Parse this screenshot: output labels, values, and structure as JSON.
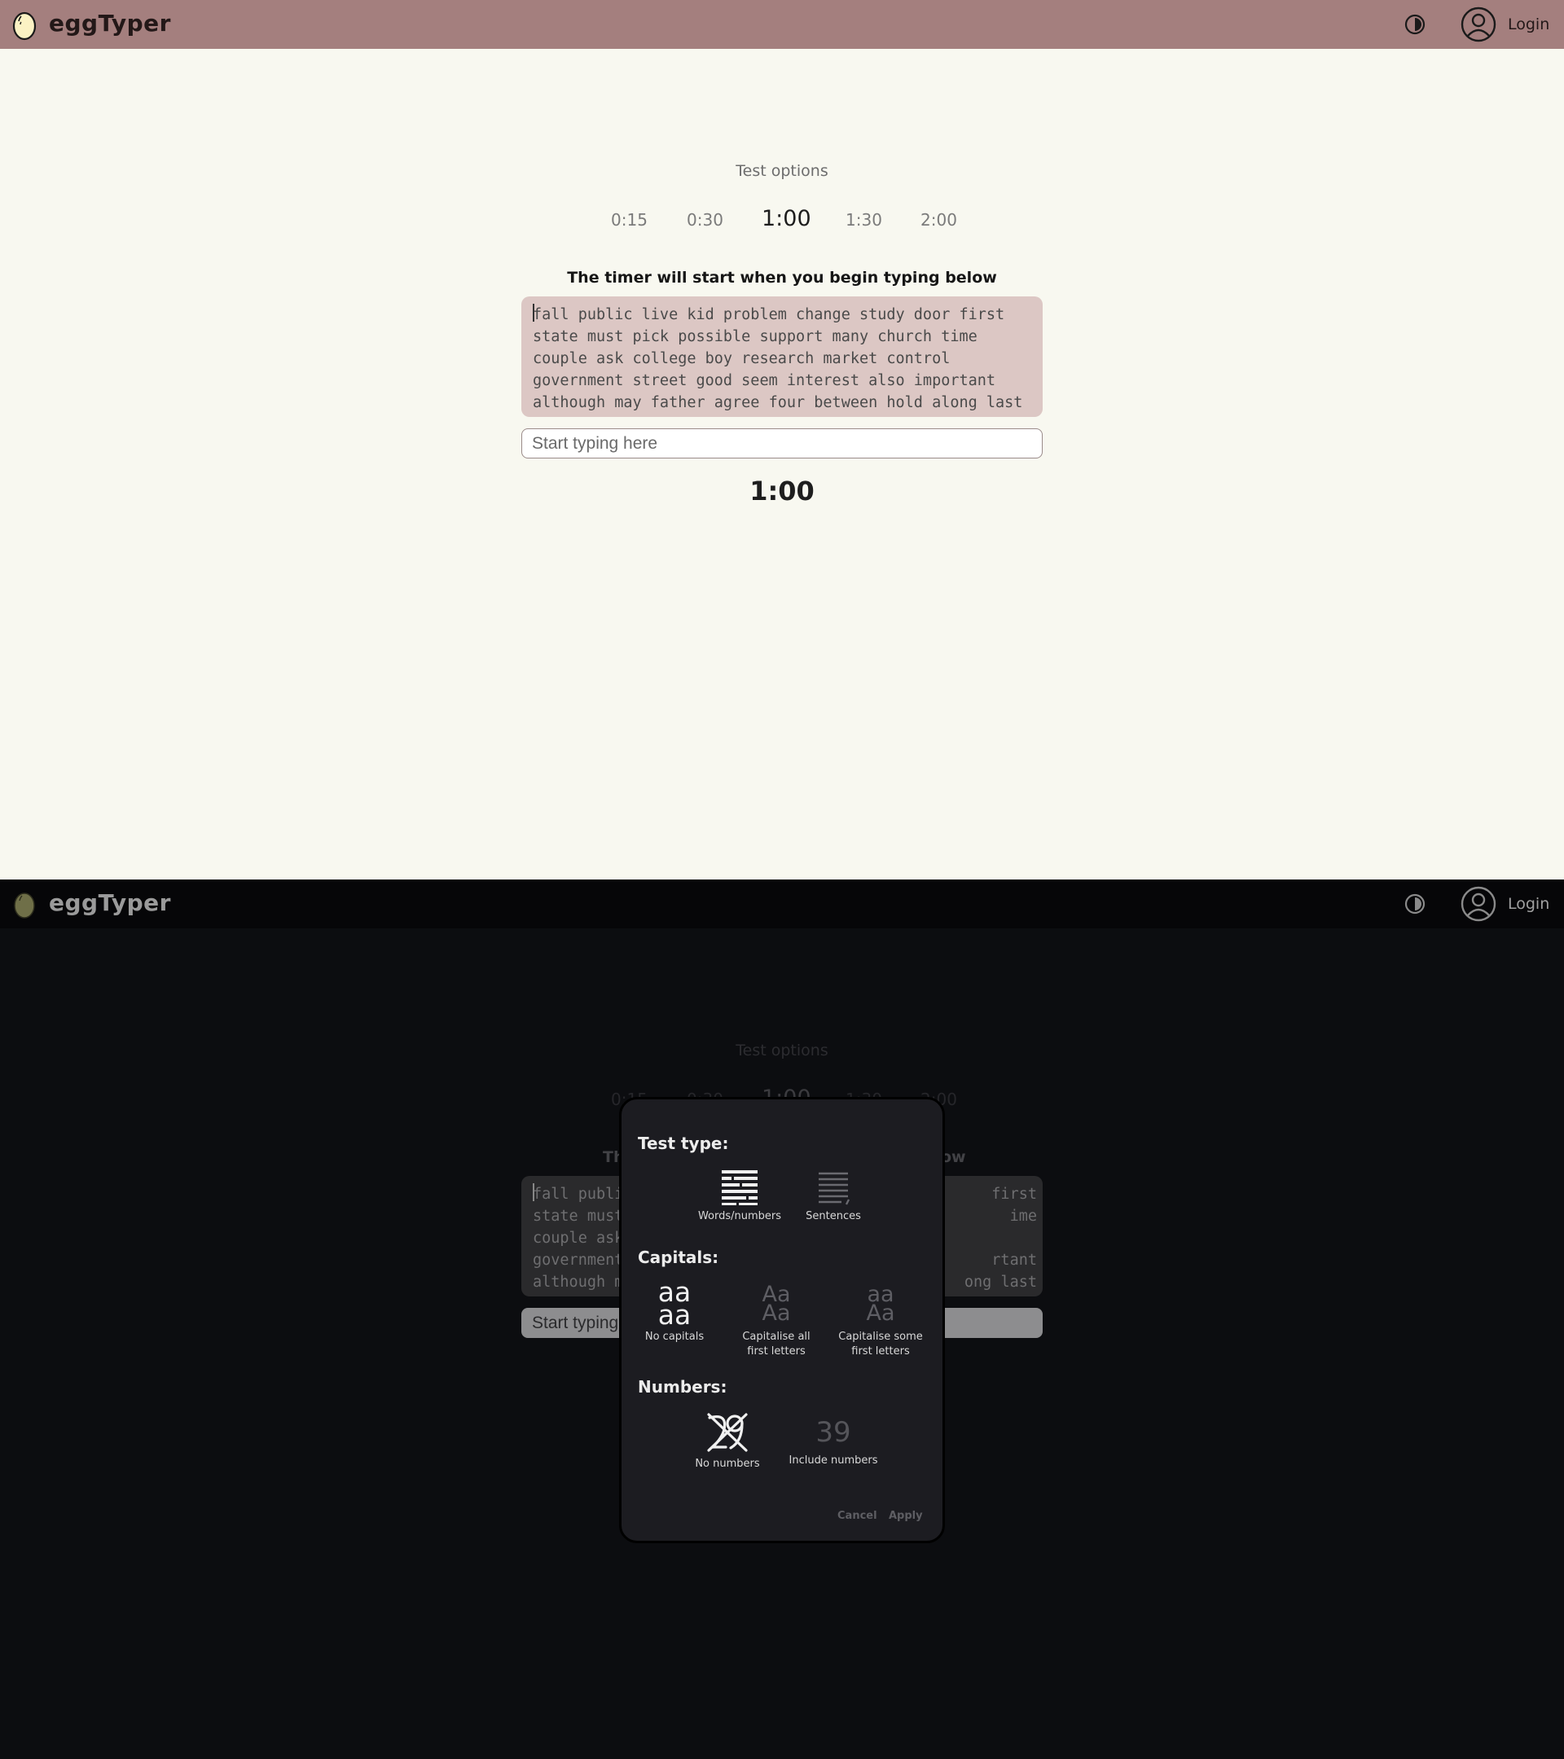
{
  "app": {
    "brand": "eggTyper"
  },
  "header": {
    "login_label": "Login"
  },
  "test_options": {
    "title": "Test options",
    "durations": [
      "0:15",
      "0:30",
      "1:00",
      "1:30",
      "2:00"
    ],
    "selected_duration": "1:00"
  },
  "typing": {
    "timer_note": "The timer will start when you begin typing below",
    "word_lines": [
      "fall public live kid problem change study door first",
      "state must pick possible support many church time",
      "couple ask college boy research market control",
      "government street good seem interest also important",
      "although may father agree four between hold along last"
    ],
    "input_placeholder": "Start typing here",
    "countdown": "1:00"
  },
  "dark_view": {
    "word_lines_left": [
      "fall publi",
      "state must",
      "couple ask",
      "government",
      "although m"
    ],
    "word_lines_right": [
      "first",
      "ime",
      "",
      "rtant",
      "ong last"
    ],
    "timer_note_left": "Th",
    "timer_note_right": "ow",
    "input_placeholder_visible": "Start typing"
  },
  "modal": {
    "test_type_title": "Test type:",
    "test_types": [
      {
        "label": "Words/numbers",
        "icon": "words-icon",
        "selected": true
      },
      {
        "label": "Sentences",
        "icon": "sentences-icon",
        "selected": false
      }
    ],
    "capitals_title": "Capitals:",
    "capitals": [
      {
        "label": "No capitals",
        "glyph_top": "aa",
        "glyph_bottom": "aa",
        "selected": true
      },
      {
        "label_line1": "Capitalise all",
        "label_line2": "first letters",
        "glyph_top": "Aa",
        "glyph_bottom": "Aa",
        "selected": false
      },
      {
        "label_line1": "Capitalise some",
        "label_line2": "first letters",
        "glyph_top": "aa",
        "glyph_bottom": "Aa",
        "selected": false
      }
    ],
    "numbers_title": "Numbers:",
    "numbers": [
      {
        "label": "No numbers",
        "icon": "no-numbers-icon",
        "selected": true
      },
      {
        "label": "Include numbers",
        "glyph": "39",
        "selected": false
      }
    ],
    "cancel_label": "Cancel",
    "apply_label": "Apply"
  },
  "colors": {
    "light_header": "#a47f7e",
    "light_background": "#f8f8f0",
    "light_words_box": "#dcc7c4",
    "dark_background": "#0c0d10",
    "modal_background": "#1c1c21"
  }
}
